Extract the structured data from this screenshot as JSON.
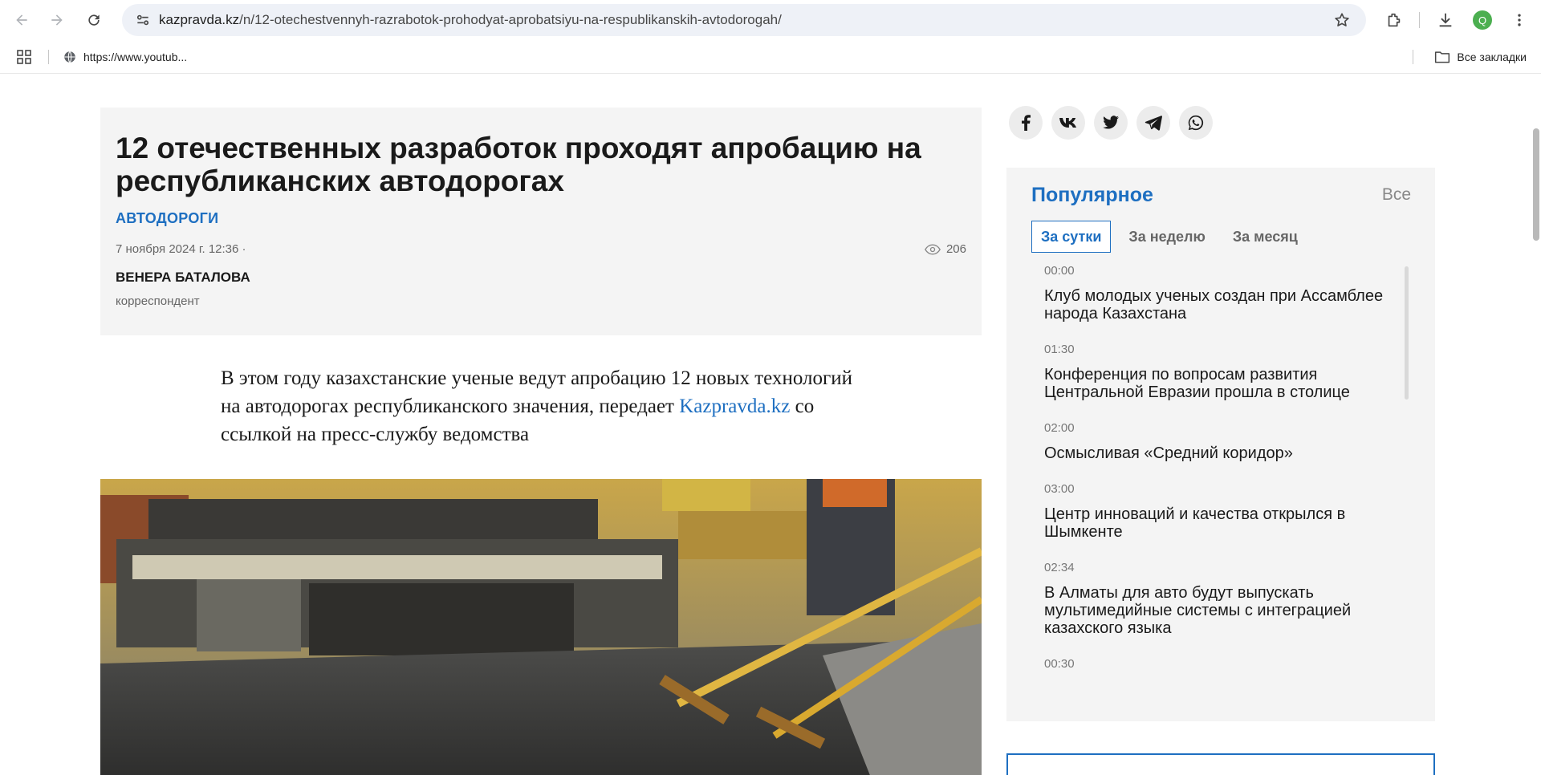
{
  "browser": {
    "url_domain": "kazpravda.kz",
    "url_path": "/n/12-otechestvennyh-razrabotok-prohodyat-aprobatsiyu-na-respublikanskih-avtodorogah/",
    "profile_initial": "Q",
    "bookmark_item": "https://www.youtub...",
    "all_bookmarks": "Все закладки"
  },
  "article": {
    "title": "12 отечественных разработок проходят апробацию на республиканских автодорогах",
    "category": "АВТОДОРОГИ",
    "date": "7 ноября 2024 г. 12:36 ·",
    "views": "206",
    "author": "ВЕНЕРА БАТАЛОВА",
    "author_role": "корреспондент",
    "lead_before": "В этом году казахстанские ученые ведут апробацию 12 новых технологий на автодорогах республиканского значения, передает ",
    "lead_link": "Kazpravda.kz",
    "lead_after": " со ссылкой на пресс-службу ведомства"
  },
  "share_icons": [
    "facebook-icon",
    "vk-icon",
    "twitter-icon",
    "telegram-icon",
    "whatsapp-icon"
  ],
  "popular": {
    "title": "Популярное",
    "all_label": "Все",
    "tabs": [
      "За сутки",
      "За неделю",
      "За месяц"
    ],
    "active_tab": 0,
    "items": [
      {
        "time": "00:00",
        "headline": "Клуб молодых ученых создан при Ассамблее народа Казахстана"
      },
      {
        "time": "01:30",
        "headline": "Конференция по вопросам развития Центральной Евразии прошла в столице"
      },
      {
        "time": "02:00",
        "headline": "Осмысливая «Средний коридор»"
      },
      {
        "time": "03:00",
        "headline": "Центр инноваций и качества открылся в Шымкенте"
      },
      {
        "time": "02:34",
        "headline": "В Алматы для авто будут выпускать мультимедийные системы с интеграцией казахского языка"
      },
      {
        "time": "00:30",
        "headline": ""
      }
    ]
  },
  "colors": {
    "accent": "#1e6fc1",
    "panel_bg": "#f4f4f4"
  }
}
